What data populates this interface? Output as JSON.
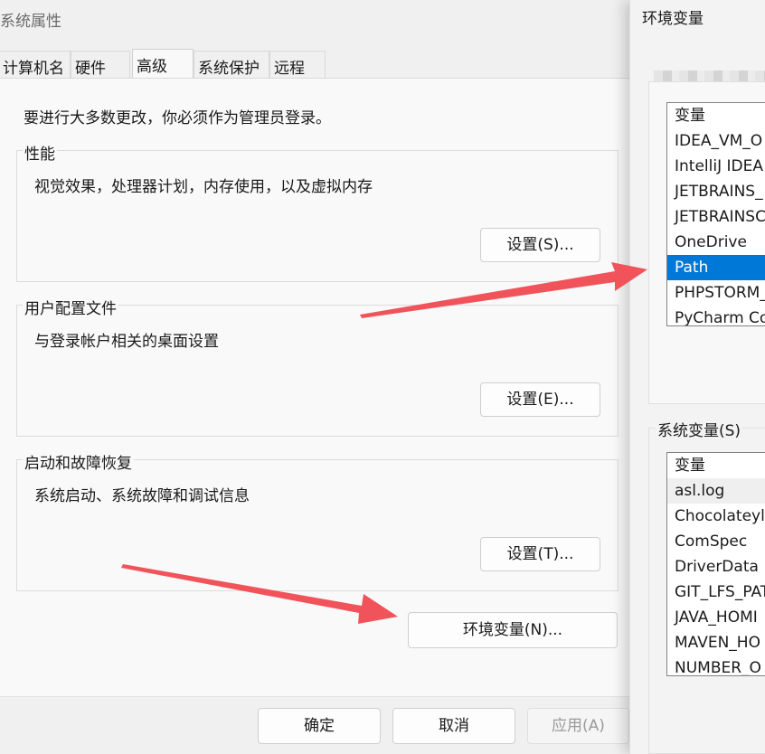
{
  "sysprops": {
    "title": "系统属性",
    "tabs": [
      "计算机名",
      "硬件",
      "高级",
      "系统保护",
      "远程"
    ],
    "active_tab": "高级",
    "intro": "要进行大多数更改，你必须作为管理员登录。",
    "groups": [
      {
        "label": "性能",
        "desc": "视觉效果，处理器计划，内存使用，以及虚拟内存",
        "button": "设置(S)..."
      },
      {
        "label": "用户配置文件",
        "desc": "与登录帐户相关的桌面设置",
        "button": "设置(E)..."
      },
      {
        "label": "启动和故障恢复",
        "desc": "系统启动、系统故障和调试信息",
        "button": "设置(T)..."
      }
    ],
    "env_button": "环境变量(N)...",
    "footer": {
      "ok": "确定",
      "cancel": "取消",
      "apply": "应用(A)"
    }
  },
  "envvars": {
    "title": "环境变量",
    "user_vars": {
      "header": "变量",
      "rows": [
        "IDEA_VM_O",
        "IntelliJ IDEA",
        "JETBRAINS_",
        "JETBRAINSC",
        "OneDrive",
        "Path",
        "PHPSTORM_",
        "PyCharm Co"
      ],
      "selected": "Path"
    },
    "system_vars": {
      "label": "系统变量(S)",
      "header": "变量",
      "rows": [
        "asl.log",
        "Chocolateyl",
        "ComSpec",
        "DriverData",
        "GIT_LFS_PAT",
        "JAVA_HOMI",
        "MAVEN_HO",
        "NUMBER_O"
      ],
      "highlighted": "asl.log"
    }
  },
  "colors": {
    "selection": "#0078d7",
    "arrow": "#f0545a"
  }
}
